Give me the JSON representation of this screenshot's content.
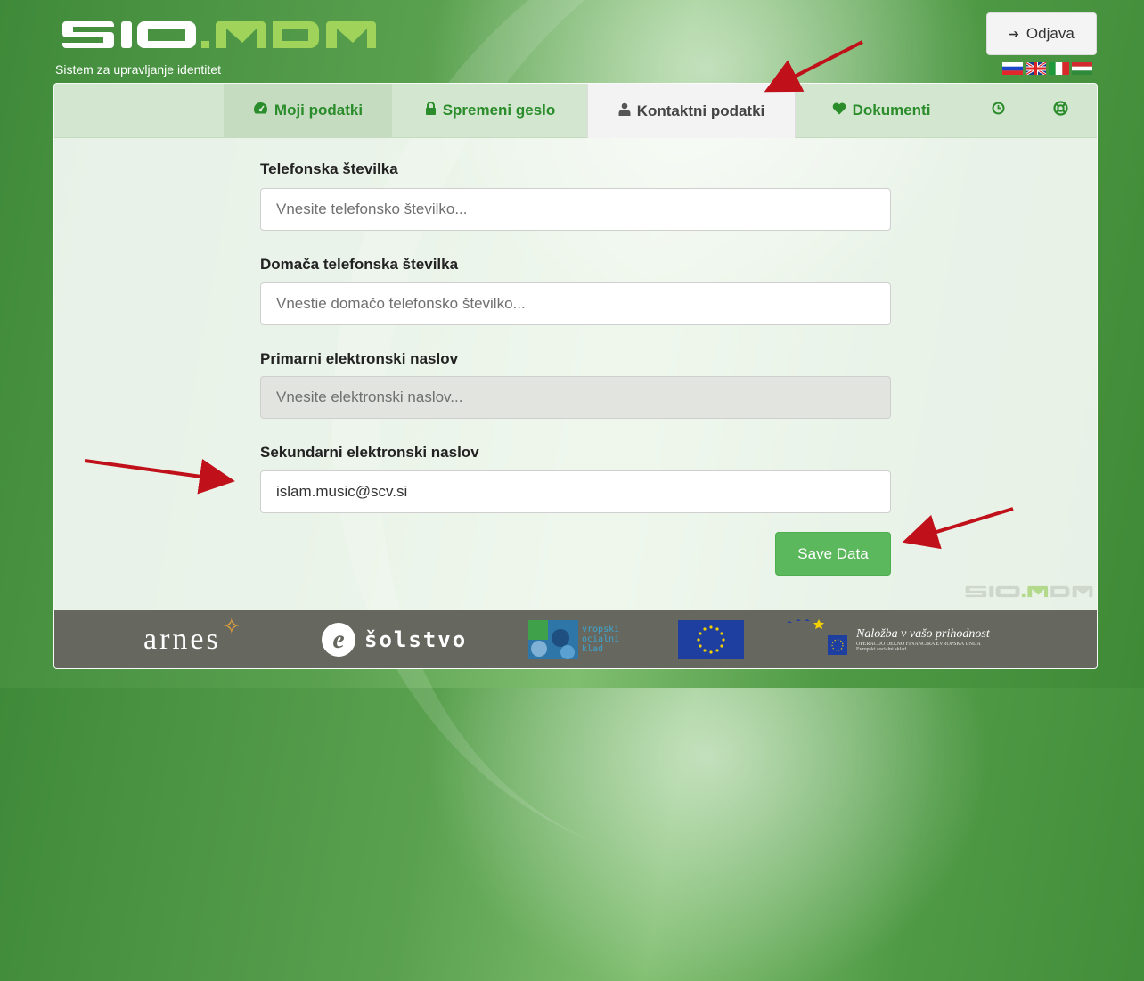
{
  "header": {
    "logo_text": "SIO.MDM",
    "tagline": "Sistem za upravljanje identitet",
    "logout_label": "Odjava",
    "logout_icon": "sign-out-icon",
    "flags": [
      "si",
      "gb",
      "it",
      "hu"
    ]
  },
  "tabs": [
    {
      "label": "Moji podatki",
      "icon": "dashboard-icon"
    },
    {
      "label": "Spremeni geslo",
      "icon": "lock-icon"
    },
    {
      "label": "Kontaktni podatki",
      "icon": "user-icon",
      "active": true
    },
    {
      "label": "Dokumenti",
      "icon": "heart-icon"
    },
    {
      "label": "",
      "icon": "clock-icon"
    },
    {
      "label": "",
      "icon": "lifebuoy-icon"
    }
  ],
  "form": {
    "phone": {
      "label": "Telefonska številka",
      "placeholder": "Vnesite telefonsko številko...",
      "value": ""
    },
    "home_phone": {
      "label": "Domača telefonska številka",
      "placeholder": "Vnestie domačo telefonsko številko...",
      "value": ""
    },
    "primary_email": {
      "label": "Primarni elektronski naslov",
      "placeholder": "Vnesite elektronski naslov...",
      "value": "",
      "disabled": true
    },
    "secondary_email": {
      "label": "Sekundarni elektronski naslov",
      "placeholder": "",
      "value": "islam.music@scv.si"
    },
    "save_label": "Save Data"
  },
  "footer": {
    "arnes": "arnes",
    "solstvo": "šolstvo",
    "esf_text": [
      "vropski",
      "ocialni",
      "klad"
    ],
    "eu_slogan": "Naložba v vašo prihodnost",
    "eu_line1": "OPERACIJO DELNO FINANCIRA EVROPSKA UNIJA",
    "eu_line2": "Evropski socialni sklad"
  },
  "colors": {
    "accent_green": "#2a8c2a",
    "save_button": "#5cb85c",
    "annotation_arrow": "#c0101a"
  }
}
